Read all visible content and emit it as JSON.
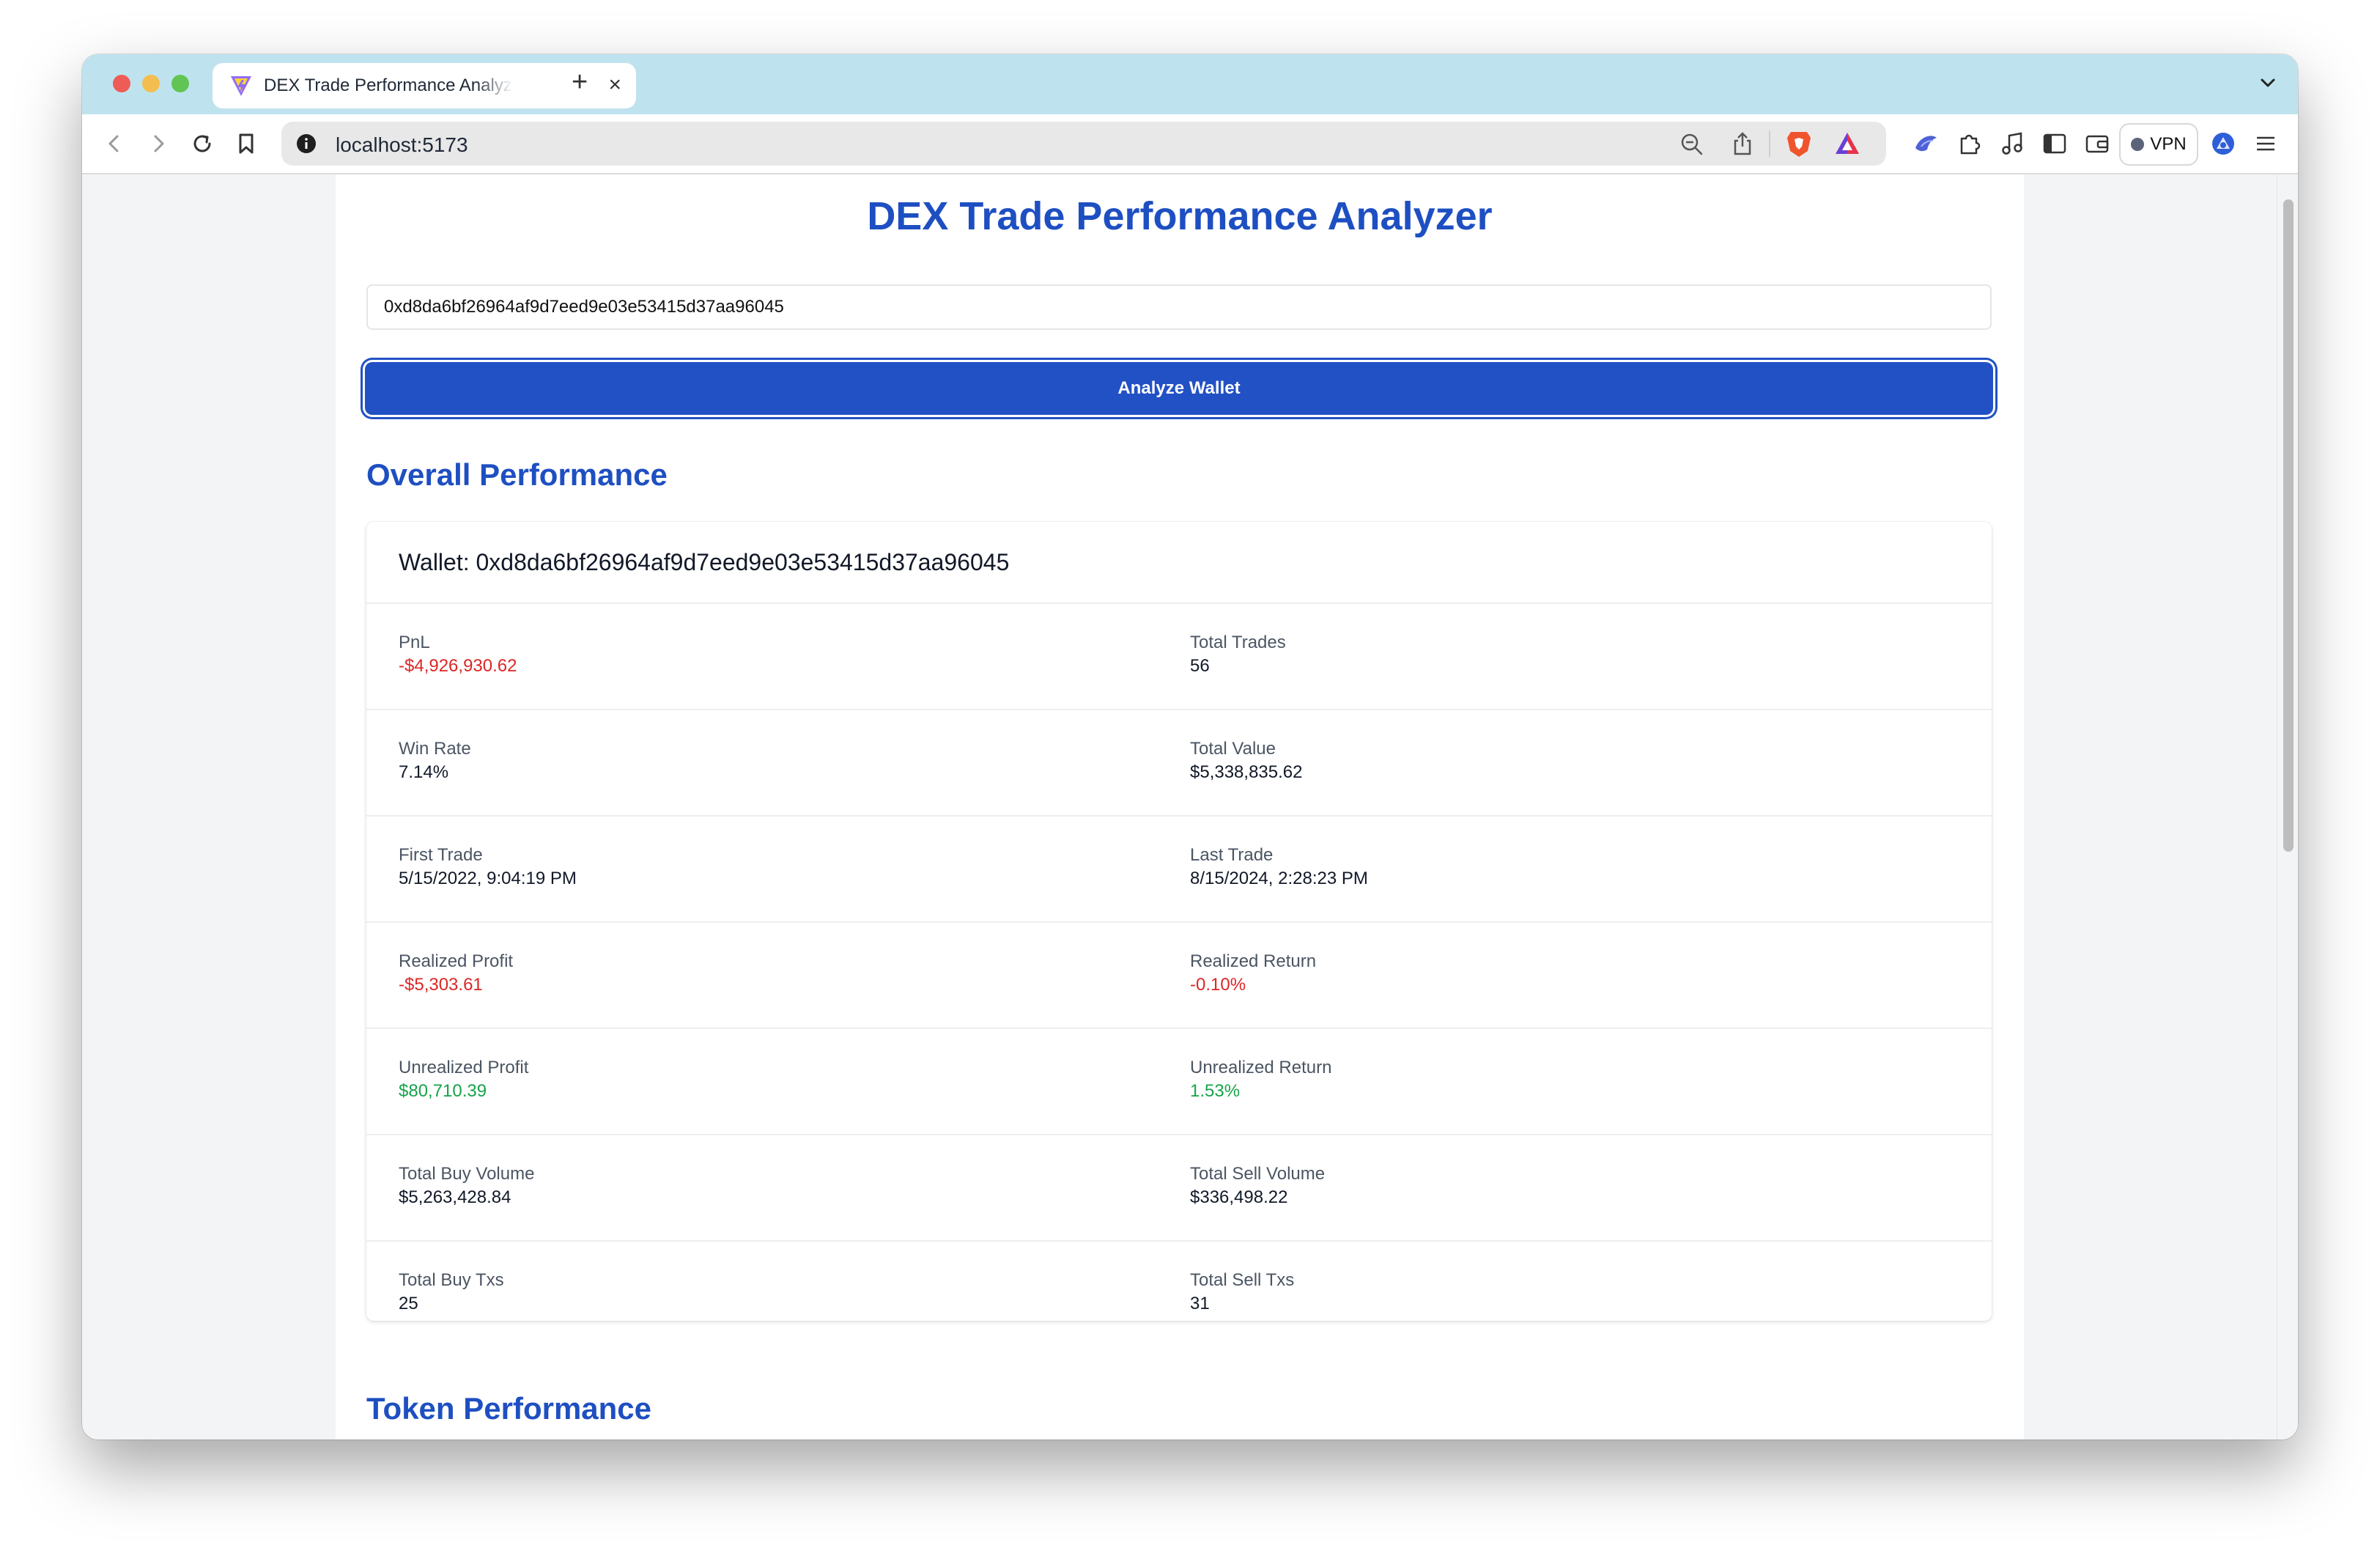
{
  "browser": {
    "tab_title": "DEX Trade Performance Analyzer",
    "url": "localhost:5173",
    "vpn_label": "VPN"
  },
  "page": {
    "title": "DEX Trade Performance Analyzer",
    "wallet_input_value": "0xd8da6bf26964af9d7eed9e03e53415d37aa96045",
    "analyze_button": "Analyze Wallet",
    "overall_section_title": "Overall Performance",
    "token_section_title": "Token Performance"
  },
  "card": {
    "wallet_header": "Wallet: 0xd8da6bf26964af9d7eed9e03e53415d37aa96045",
    "rows": [
      {
        "left": {
          "label": "PnL",
          "value": "-$4,926,930.62",
          "tone": "negative"
        },
        "right": {
          "label": "Total Trades",
          "value": "56",
          "tone": "neutral"
        }
      },
      {
        "left": {
          "label": "Win Rate",
          "value": "7.14%",
          "tone": "neutral"
        },
        "right": {
          "label": "Total Value",
          "value": "$5,338,835.62",
          "tone": "neutral"
        }
      },
      {
        "left": {
          "label": "First Trade",
          "value": "5/15/2022, 9:04:19 PM",
          "tone": "neutral"
        },
        "right": {
          "label": "Last Trade",
          "value": "8/15/2024, 2:28:23 PM",
          "tone": "neutral"
        }
      },
      {
        "left": {
          "label": "Realized Profit",
          "value": "-$5,303.61",
          "tone": "negative"
        },
        "right": {
          "label": "Realized Return",
          "value": "-0.10%",
          "tone": "negative"
        }
      },
      {
        "left": {
          "label": "Unrealized Profit",
          "value": "$80,710.39",
          "tone": "positive"
        },
        "right": {
          "label": "Unrealized Return",
          "value": "1.53%",
          "tone": "positive"
        }
      },
      {
        "left": {
          "label": "Total Buy Volume",
          "value": "$5,263,428.84",
          "tone": "neutral"
        },
        "right": {
          "label": "Total Sell Volume",
          "value": "$336,498.22",
          "tone": "neutral"
        }
      },
      {
        "left": {
          "label": "Total Buy Txs",
          "value": "25",
          "tone": "neutral"
        },
        "right": {
          "label": "Total Sell Txs",
          "value": "31",
          "tone": "neutral"
        }
      }
    ]
  },
  "colors": {
    "accent": "#1e4fc2",
    "button": "#2151c4",
    "negative": "#dc2626",
    "positive": "#16a34a"
  }
}
